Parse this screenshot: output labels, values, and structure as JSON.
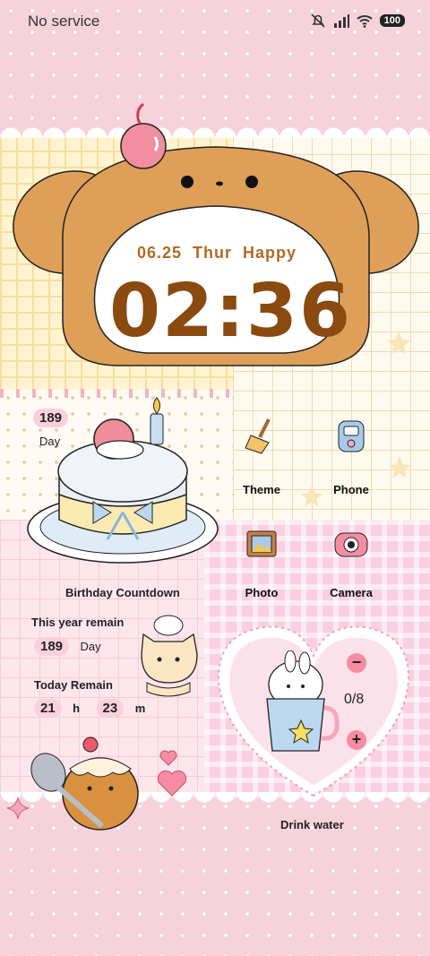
{
  "status_bar": {
    "carrier": "No service",
    "battery": "100"
  },
  "clock": {
    "date": "06.25",
    "weekday": "Thur",
    "greeting": "Happy",
    "time": "02:36"
  },
  "birthday": {
    "days_value": "189",
    "days_unit": "Day",
    "title": "Birthday Countdown",
    "year_label": "This year remain",
    "year_value": "189",
    "year_unit": "Day",
    "today_label": "Today Remain",
    "hours_value": "21",
    "hours_unit": "h",
    "minutes_value": "23",
    "minutes_unit": "m"
  },
  "apps": [
    {
      "label": "Theme",
      "icon": "broom-icon"
    },
    {
      "label": "Phone",
      "icon": "phone-icon"
    },
    {
      "label": "Photo",
      "icon": "photo-icon"
    },
    {
      "label": "Camera",
      "icon": "camera-icon"
    }
  ],
  "water": {
    "count": "0/8",
    "label": "Drink water",
    "minus": "−",
    "plus": "+"
  }
}
